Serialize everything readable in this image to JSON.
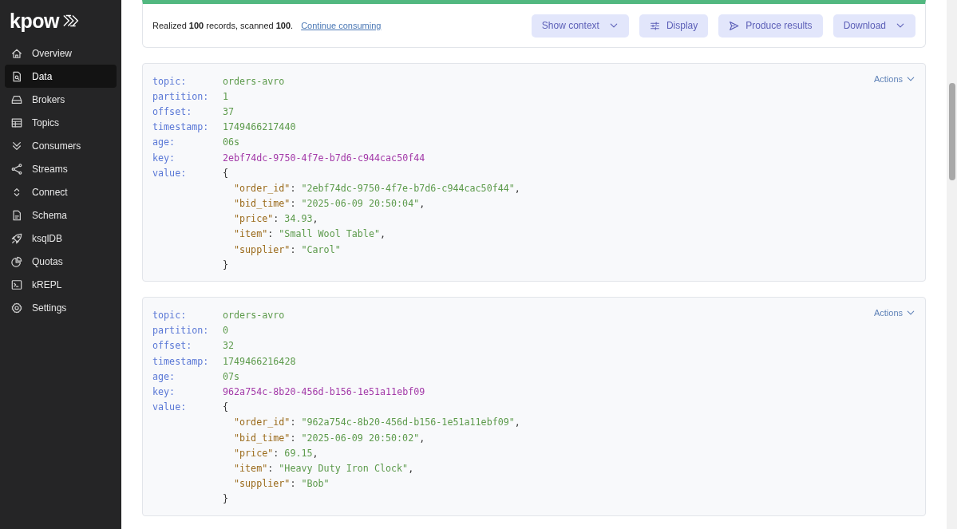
{
  "sidebar": {
    "logo": "kpow",
    "items": [
      {
        "label": "Overview",
        "selected": false
      },
      {
        "label": "Data",
        "selected": true
      },
      {
        "label": "Brokers",
        "selected": false
      },
      {
        "label": "Topics",
        "selected": false
      },
      {
        "label": "Consumers",
        "selected": false
      },
      {
        "label": "Streams",
        "selected": false
      },
      {
        "label": "Connect",
        "selected": false
      },
      {
        "label": "Schema",
        "selected": false
      },
      {
        "label": "ksqlDB",
        "selected": false
      },
      {
        "label": "Quotas",
        "selected": false
      },
      {
        "label": "kREPL",
        "selected": false
      },
      {
        "label": "Settings",
        "selected": false
      }
    ]
  },
  "summary": {
    "text": "Realized **100** records, scanned **100**.",
    "link": "Continue consuming"
  },
  "toolbar": [
    {
      "label": "Show context"
    },
    {
      "label": "Display"
    },
    {
      "label": "Produce results"
    },
    {
      "label": "Download"
    }
  ],
  "records": [
    {
      "actions": "Actions",
      "meta": [
        {
          "label": "topic:",
          "value": "orders-avro",
          "kind": "plain"
        },
        {
          "label": "partition:",
          "value": "1",
          "kind": "plain"
        },
        {
          "label": "offset:",
          "value": "37",
          "kind": "plain"
        },
        {
          "label": "timestamp:",
          "value": "1749466217440",
          "kind": "plain"
        },
        {
          "label": "age:",
          "value": "06s",
          "kind": "plain"
        },
        {
          "label": "key:",
          "value": "2ebf74dc-9750-4f7e-b7d6-c944cac50f44",
          "kind": "key"
        }
      ],
      "value_label": "value:",
      "open": "{",
      "close": "}",
      "fields": [
        {
          "key": "\"order_id\"",
          "sep": ": ",
          "value": "\"2ebf74dc-9750-4f7e-b7d6-c944cac50f44\"",
          "comma": ","
        },
        {
          "key": "\"bid_time\"",
          "sep": ": ",
          "value": "\"2025-06-09 20:50:04\"",
          "comma": ","
        },
        {
          "key": "\"price\"",
          "sep": ": ",
          "value": "34.93",
          "comma": ","
        },
        {
          "key": "\"item\"",
          "sep": ": ",
          "value": "\"Small Wool Table\"",
          "comma": ","
        },
        {
          "key": "\"supplier\"",
          "sep": ": ",
          "value": "\"Carol\""
        }
      ]
    },
    {
      "actions": "Actions",
      "meta": [
        {
          "label": "topic:",
          "value": "orders-avro",
          "kind": "plain"
        },
        {
          "label": "partition:",
          "value": "0",
          "kind": "plain"
        },
        {
          "label": "offset:",
          "value": "32",
          "kind": "plain"
        },
        {
          "label": "timestamp:",
          "value": "1749466216428",
          "kind": "plain"
        },
        {
          "label": "age:",
          "value": "07s",
          "kind": "plain"
        },
        {
          "label": "key:",
          "value": "962a754c-8b20-456d-b156-1e51a11ebf09",
          "kind": "key"
        }
      ],
      "value_label": "value:",
      "open": "{",
      "close": "}",
      "fields": [
        {
          "key": "\"order_id\"",
          "sep": ": ",
          "value": "\"962a754c-8b20-456d-b156-1e51a11ebf09\"",
          "comma": ","
        },
        {
          "key": "\"bid_time\"",
          "sep": ": ",
          "value": "\"2025-06-09 20:50:02\"",
          "comma": ","
        },
        {
          "key": "\"price\"",
          "sep": ": ",
          "value": "69.15",
          "comma": ","
        },
        {
          "key": "\"item\"",
          "sep": ": ",
          "value": "\"Heavy Duty Iron Clock\"",
          "comma": ","
        },
        {
          "key": "\"supplier\"",
          "sep": ": ",
          "value": "\"Bob\""
        }
      ]
    }
  ]
}
